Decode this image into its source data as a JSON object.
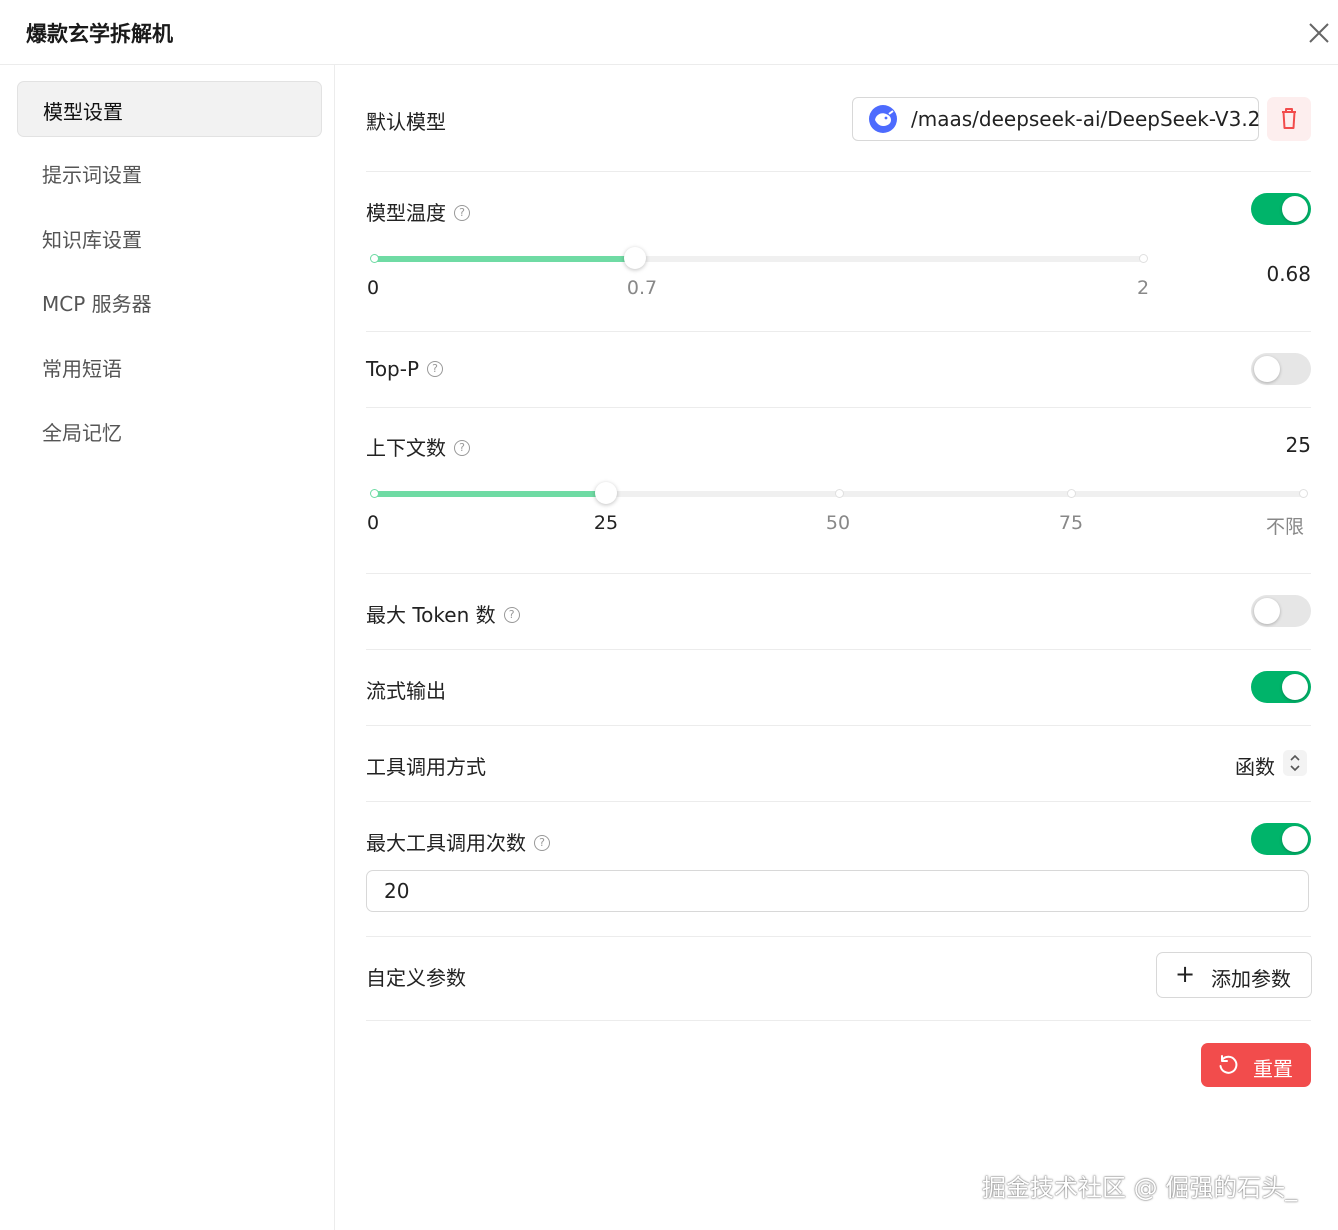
{
  "window": {
    "title": "爆款玄学拆解机"
  },
  "sidebar": {
    "items": [
      {
        "label": "模型设置",
        "active": true
      },
      {
        "label": "提示词设置"
      },
      {
        "label": "知识库设置"
      },
      {
        "label": "MCP 服务器"
      },
      {
        "label": "常用短语"
      },
      {
        "label": "全局记忆"
      }
    ]
  },
  "settings": {
    "default_model": {
      "label": "默认模型",
      "value": "/maas/deepseek-ai/DeepSeek-V3.2"
    },
    "temperature": {
      "label": "模型温度",
      "enabled": true,
      "value": "0.68",
      "min": 0,
      "max": 2,
      "position": 0.68,
      "ticks": [
        "0",
        "0.7",
        "2"
      ]
    },
    "top_p": {
      "label": "Top-P",
      "enabled": false
    },
    "context_count": {
      "label": "上下文数",
      "value": "25",
      "position": 25,
      "ticks": [
        "0",
        "25",
        "50",
        "75",
        "不限"
      ]
    },
    "max_tokens": {
      "label": "最大 Token 数",
      "enabled": false
    },
    "stream_output": {
      "label": "流式输出",
      "enabled": true
    },
    "tool_call_mode": {
      "label": "工具调用方式",
      "value": "函数"
    },
    "max_tool_calls": {
      "label": "最大工具调用次数",
      "enabled": true,
      "value": "20"
    },
    "custom_params": {
      "label": "自定义参数",
      "add_button": "添加参数"
    },
    "reset_button": "重置"
  },
  "watermark": "掘金技术社区 @ 倔强的石头_",
  "colors": {
    "accent": "#00b46a",
    "slider_fill": "#6fdba4",
    "danger": "#f24c4c",
    "model_icon": "#4d6bfe"
  }
}
